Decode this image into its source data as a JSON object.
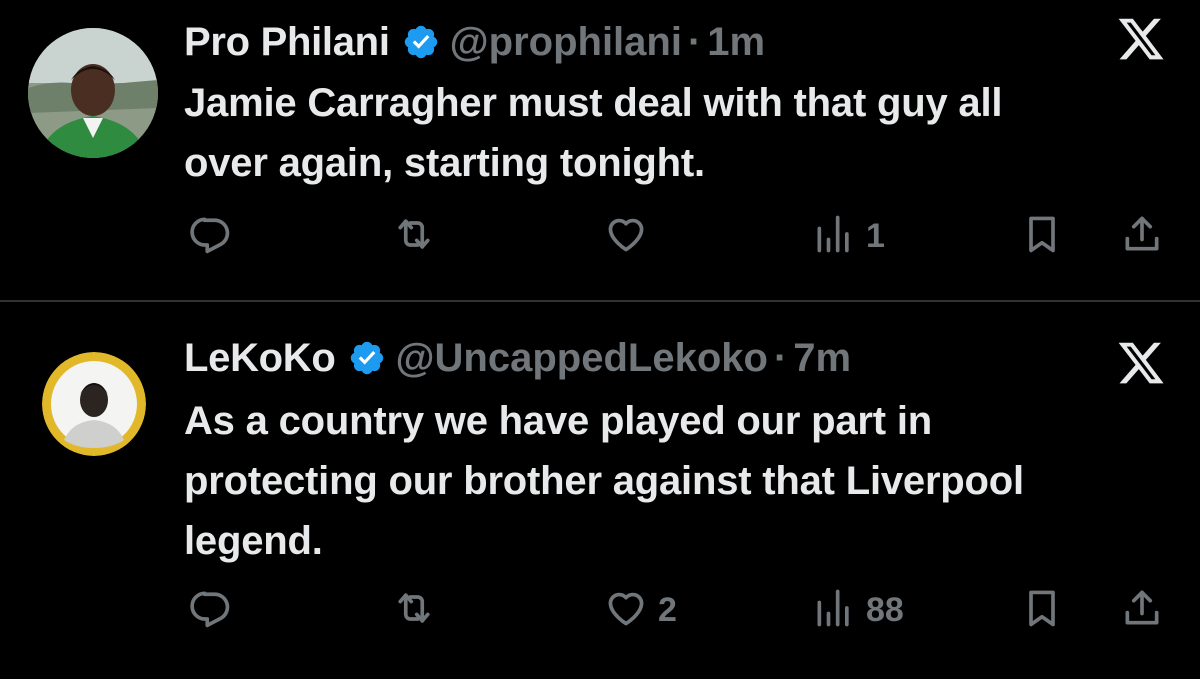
{
  "tweets": [
    {
      "name": "Pro Philani",
      "handle": "@prophilani",
      "separator": "·",
      "time": "1m",
      "text_lines": [
        "Jamie Carragher must deal with that guy all",
        "over again, starting tonight."
      ],
      "counts": {
        "reply": "",
        "repost": "",
        "like": "",
        "views": "1"
      },
      "avatar": "photo of man in green jacket"
    },
    {
      "name": "LeKoKo",
      "handle": "@UncappedLekoko",
      "separator": "·",
      "time": "7m",
      "text_lines": [
        "As a country we have played our part in",
        "protecting our brother against that Liverpool",
        "legend."
      ],
      "counts": {
        "reply": "",
        "repost": "",
        "like": "2",
        "views": "88"
      },
      "avatar": "round portrait with yellow ring"
    }
  ],
  "icons": {
    "verified": "verified-badge-icon",
    "platform": "x-logo-icon",
    "reply": "reply-icon",
    "repost": "repost-icon",
    "like": "heart-icon",
    "views": "views-icon",
    "bookmark": "bookmark-icon",
    "share": "share-icon"
  },
  "colors": {
    "background": "#000000",
    "text": "#e7e9ea",
    "muted": "#71767b",
    "verified": "#1d9bf0",
    "divider": "#2f3336"
  }
}
